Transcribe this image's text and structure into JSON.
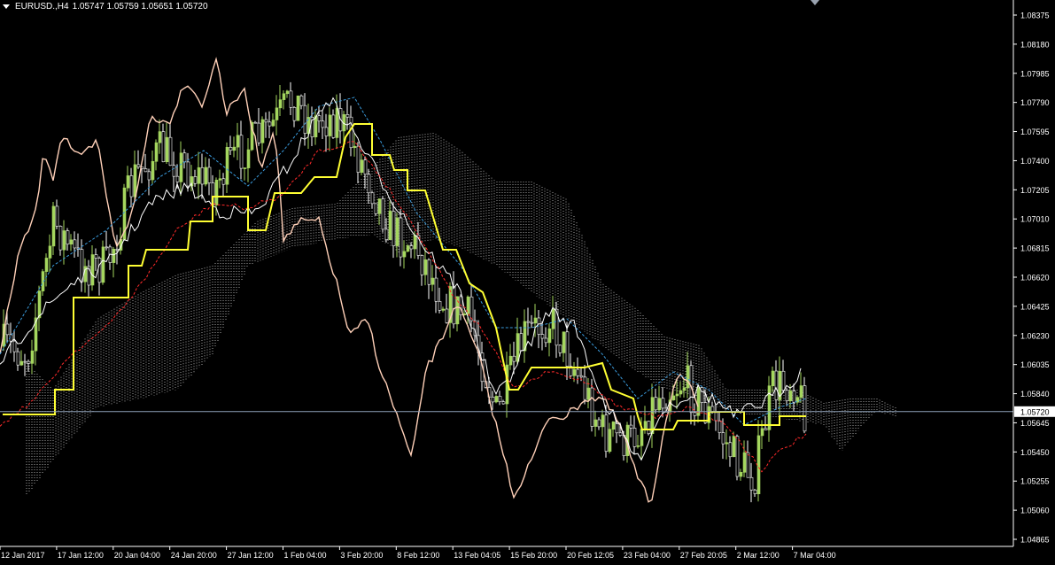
{
  "window": {
    "symbol_timeframe": "EURUSD.,H4",
    "ohlc": "1.05747 1.05759 1.05651 1.05720"
  },
  "colors": {
    "background": "#000000",
    "axis": "#ffffff",
    "candle_up": "#a4d65e",
    "candle_down": "#ffffff",
    "kijun": "#ffff33",
    "tenkan": "#ff2a2a",
    "chikou": "#ffd0b8",
    "cloud": "#cfcfcf",
    "ma_blue": "#3a9bdc",
    "price_line": "#8ea0b8"
  },
  "price_axis": {
    "labels": [
      "1.08375",
      "1.08180",
      "1.07985",
      "1.07790",
      "1.07595",
      "1.07400",
      "1.07205",
      "1.07010",
      "1.06815",
      "1.06620",
      "1.06425",
      "1.06230",
      "1.06035",
      "1.05840",
      "1.05645",
      "1.05450",
      "1.05255",
      "1.05060",
      "1.04865"
    ],
    "current_price": "1.05720"
  },
  "time_axis": {
    "labels": [
      "12 Jan 2017",
      "17 Jan 12:00",
      "20 Jan 04:00",
      "24 Jan 20:00",
      "27 Jan 12:00",
      "1 Feb 04:00",
      "3 Feb 20:00",
      "8 Feb 12:00",
      "13 Feb 04:05",
      "15 Feb 20:00",
      "20 Feb 12:05",
      "23 Feb 04:00",
      "27 Feb 20:05",
      "2 Mar 12:00",
      "7 Mar 04:00"
    ]
  }
}
